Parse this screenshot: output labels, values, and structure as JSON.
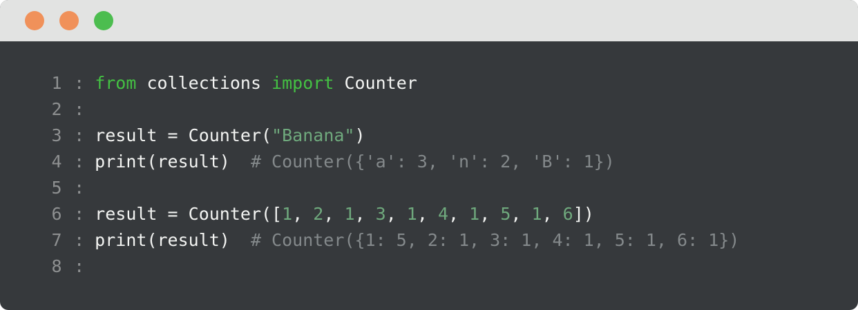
{
  "window": {
    "buttons": [
      {
        "name": "close",
        "color": "#f0915a"
      },
      {
        "name": "minimize",
        "color": "#f0915a"
      },
      {
        "name": "maximize",
        "color": "#4cbd4f"
      }
    ]
  },
  "code": {
    "separator": ":",
    "lines": [
      {
        "number": "1",
        "tokens": [
          {
            "text": " ",
            "kind": "plain"
          },
          {
            "text": "from",
            "kind": "kw"
          },
          {
            "text": " collections ",
            "kind": "plain"
          },
          {
            "text": "import",
            "kind": "kw"
          },
          {
            "text": " Counter",
            "kind": "plain"
          }
        ]
      },
      {
        "number": "2",
        "tokens": []
      },
      {
        "number": "3",
        "tokens": [
          {
            "text": " result = Counter(",
            "kind": "plain"
          },
          {
            "text": "\"Banana\"",
            "kind": "str"
          },
          {
            "text": ")",
            "kind": "plain"
          }
        ]
      },
      {
        "number": "4",
        "tokens": [
          {
            "text": " print(result)  ",
            "kind": "plain"
          },
          {
            "text": "# Counter({'a': 3, 'n': 2, 'B': 1})",
            "kind": "cm"
          }
        ]
      },
      {
        "number": "5",
        "tokens": []
      },
      {
        "number": "6",
        "tokens": [
          {
            "text": " result = Counter([",
            "kind": "plain"
          },
          {
            "text": "1",
            "kind": "num"
          },
          {
            "text": ", ",
            "kind": "plain"
          },
          {
            "text": "2",
            "kind": "num"
          },
          {
            "text": ", ",
            "kind": "plain"
          },
          {
            "text": "1",
            "kind": "num"
          },
          {
            "text": ", ",
            "kind": "plain"
          },
          {
            "text": "3",
            "kind": "num"
          },
          {
            "text": ", ",
            "kind": "plain"
          },
          {
            "text": "1",
            "kind": "num"
          },
          {
            "text": ", ",
            "kind": "plain"
          },
          {
            "text": "4",
            "kind": "num"
          },
          {
            "text": ", ",
            "kind": "plain"
          },
          {
            "text": "1",
            "kind": "num"
          },
          {
            "text": ", ",
            "kind": "plain"
          },
          {
            "text": "5",
            "kind": "num"
          },
          {
            "text": ", ",
            "kind": "plain"
          },
          {
            "text": "1",
            "kind": "num"
          },
          {
            "text": ", ",
            "kind": "plain"
          },
          {
            "text": "6",
            "kind": "num"
          },
          {
            "text": "])",
            "kind": "plain"
          }
        ]
      },
      {
        "number": "7",
        "tokens": [
          {
            "text": " print(result)  ",
            "kind": "plain"
          },
          {
            "text": "# Counter({1: 5, 2: 1, 3: 1, 4: 1, 5: 1, 6: 1})",
            "kind": "cm"
          }
        ]
      },
      {
        "number": "8",
        "tokens": []
      }
    ]
  }
}
